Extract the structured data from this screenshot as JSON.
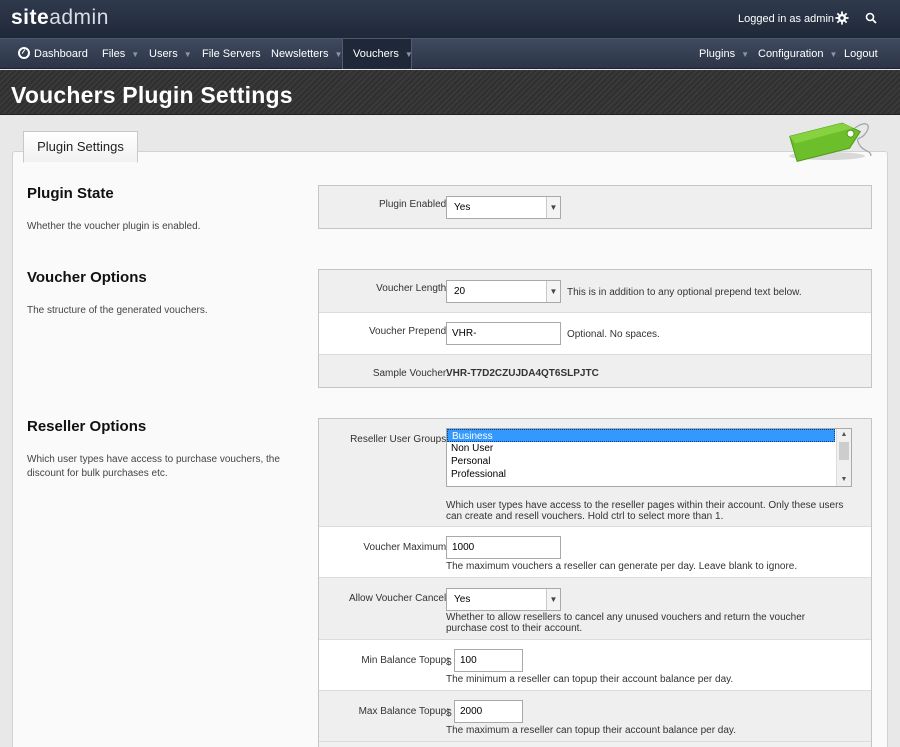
{
  "header": {
    "logo_bold": "site",
    "logo_light": "admin",
    "logged_in": "Logged in as admin",
    "icons": [
      "gear-icon",
      "search-icon"
    ]
  },
  "nav": {
    "left": [
      {
        "label": "Dashboard",
        "caret": false
      },
      {
        "label": "Files",
        "caret": true
      },
      {
        "label": "Users",
        "caret": true
      },
      {
        "label": "File Servers",
        "caret": false
      },
      {
        "label": "Newsletters",
        "caret": true
      },
      {
        "label": "Vouchers",
        "caret": true,
        "active": true
      }
    ],
    "right": [
      {
        "label": "Plugins",
        "caret": true
      },
      {
        "label": "Configuration",
        "caret": true
      },
      {
        "label": "Logout",
        "caret": false
      }
    ]
  },
  "page": {
    "title": "Vouchers Plugin Settings",
    "tab": "Plugin Settings"
  },
  "plugin_state": {
    "title": "Plugin State",
    "desc": "Whether the voucher plugin is enabled.",
    "enabled_label": "Plugin Enabled:",
    "enabled_value": "Yes"
  },
  "voucher_options": {
    "title": "Voucher Options",
    "desc": "The structure of the generated vouchers.",
    "length_label": "Voucher Length:",
    "length_value": "20",
    "length_hint": "This is in addition to any optional prepend text below.",
    "prepend_label": "Voucher Prepend:",
    "prepend_value": "VHR-",
    "prepend_hint": "Optional. No spaces.",
    "sample_label": "Sample Voucher:",
    "sample_value": "VHR-T7D2CZUJDA4QT6SLPJTC"
  },
  "reseller_options": {
    "title": "Reseller Options",
    "desc": "Which user types have access to purchase vouchers, the discount for bulk purchases etc.",
    "groups_label": "Reseller User Groups:",
    "groups": [
      {
        "label": "Business",
        "selected": true
      },
      {
        "label": "Non User",
        "selected": false
      },
      {
        "label": "Personal",
        "selected": false
      },
      {
        "label": "Professional",
        "selected": false
      }
    ],
    "groups_hint": "Which user types have access to the reseller pages within their account. Only these users can create and resell vouchers. Hold ctrl to select more than 1.",
    "max_label": "Voucher Maximum:",
    "max_value": "1000",
    "max_hint": "The maximum vouchers a reseller can generate per day. Leave blank to ignore.",
    "cancel_label": "Allow Voucher Cancel:",
    "cancel_value": "Yes",
    "cancel_hint": "Whether to allow resellers to cancel any unused vouchers and return the voucher purchase cost to their account.",
    "min_topup_label": "Min Balance Topup:",
    "currency": "$",
    "min_topup_value": "100",
    "min_topup_hint": "The minimum a reseller can topup their account balance per day.",
    "max_topup_label": "Max Balance Topup:",
    "max_topup_value": "2000",
    "max_topup_hint": "The maximum a reseller can topup their account balance per day."
  }
}
